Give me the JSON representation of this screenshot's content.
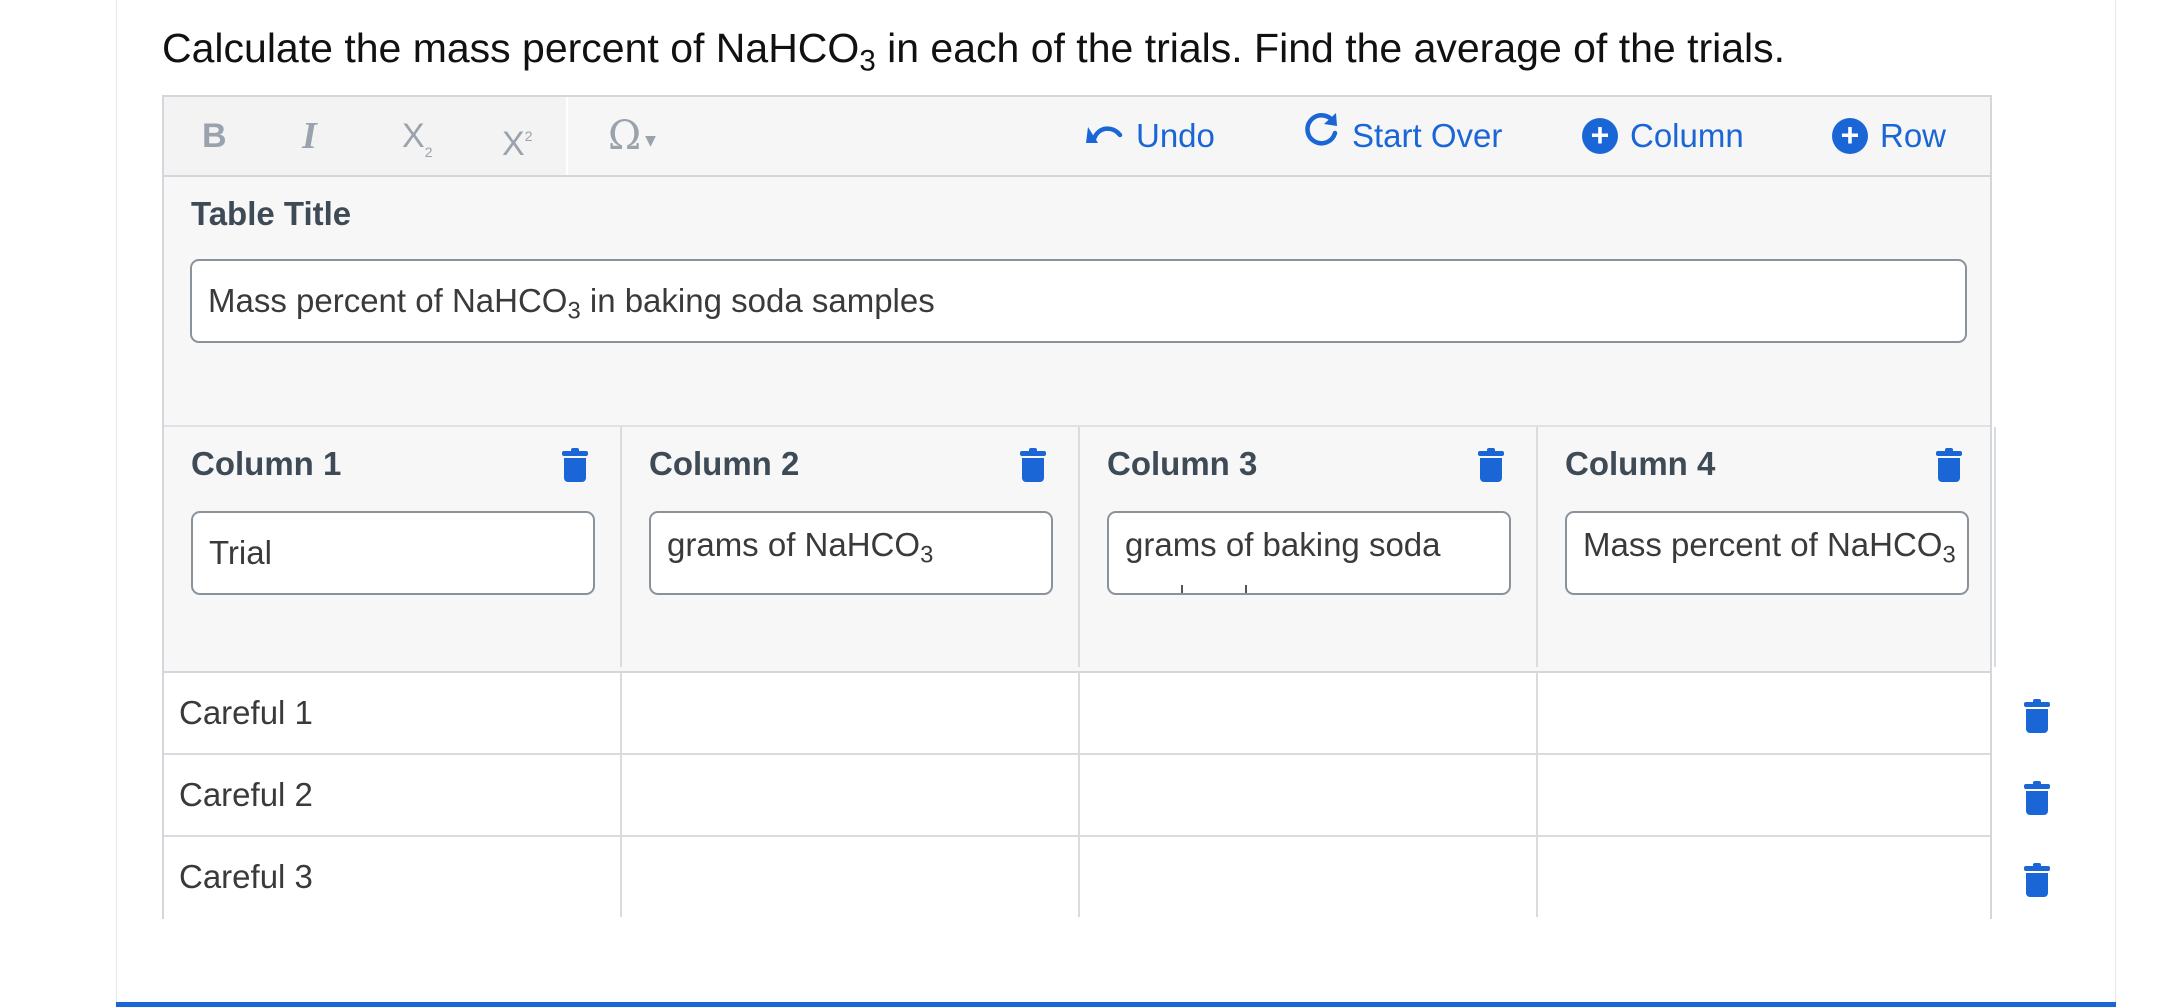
{
  "prompt": {
    "before": "Calculate the mass percent of NaHCO",
    "sub": "3",
    "after": " in each of the trials.  Find the average of the trials."
  },
  "toolbar": {
    "bold_label": "B",
    "italic_label": "I",
    "subscript_label": "X",
    "subscript_mark": "2",
    "superscript_label": "X",
    "superscript_mark": "2",
    "symbol_label": "Ω",
    "undo_label": "Undo",
    "start_over_label": "Start Over",
    "add_column_label": "Column",
    "add_row_label": "Row"
  },
  "table_title": {
    "label": "Table Title",
    "value_before": "Mass percent of NaHCO",
    "value_sub": "3",
    "value_after": " in baking soda samples"
  },
  "columns": [
    {
      "label": "Column 1",
      "value": "Trial",
      "sub": "",
      "after": ""
    },
    {
      "label": "Column 2",
      "value": "grams of NaHCO",
      "sub": "3",
      "after": ""
    },
    {
      "label": "Column 3",
      "value": "grams of baking soda",
      "sub": "",
      "after": ""
    },
    {
      "label": "Column 4",
      "value": "Mass percent of NaHCO",
      "sub": "3",
      "after": ""
    }
  ],
  "rows": [
    {
      "cells": [
        "Careful 1",
        "",
        "",
        ""
      ]
    },
    {
      "cells": [
        "Careful 2",
        "",
        "",
        ""
      ]
    },
    {
      "cells": [
        "Careful 3",
        "",
        "",
        ""
      ]
    }
  ],
  "colors": {
    "accent": "#1a66d6",
    "toolbar_icon": "#9aa3ad",
    "border": "#d3d7db"
  },
  "icons": {
    "undo": "undo-icon",
    "start_over": "refresh-icon",
    "add": "plus-circle-icon",
    "delete": "trash-icon"
  }
}
